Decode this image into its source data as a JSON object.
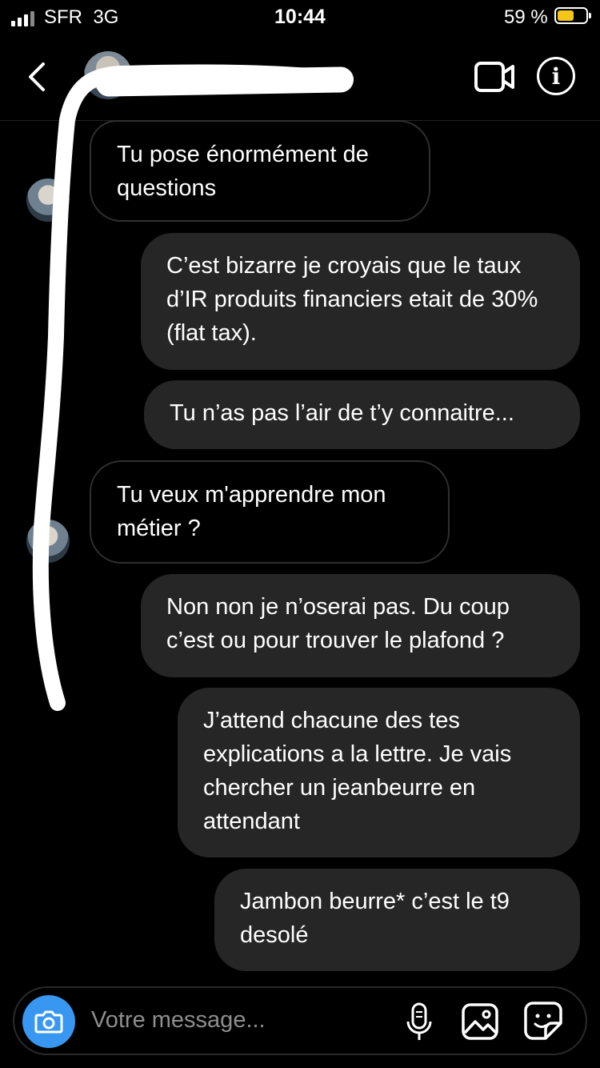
{
  "status_bar": {
    "carrier": "SFR",
    "network": "3G",
    "time": "10:44",
    "battery_percent": "59 %",
    "battery_level": 0.59
  },
  "header": {
    "contact_name": "",
    "icons": [
      "chevron-left-icon",
      "video-call-icon",
      "info-icon"
    ]
  },
  "messages": [
    {
      "side": "in",
      "text": "Tu pose énormément de questions"
    },
    {
      "side": "out",
      "text": "C’est bizarre je croyais que le taux d’IR produits financiers etait de 30% (flat tax)."
    },
    {
      "side": "out",
      "text": "Tu n’as pas l’air de t’y connaitre..."
    },
    {
      "side": "in",
      "text": "Tu veux m'apprendre mon métier ?"
    },
    {
      "side": "out",
      "text": "Non non je n’oserai pas. Du coup c’est ou pour trouver le plafond ?"
    },
    {
      "side": "out",
      "text": "J’attend chacune des tes explications a la lettre. Je vais chercher un jeanbeurre en attendant"
    },
    {
      "side": "out",
      "text": "Jambon beurre* c’est le t9 desolé"
    }
  ],
  "composer": {
    "placeholder": "Votre message...",
    "accent_color": "#3897f0",
    "icons": [
      "camera-icon",
      "microphone-icon",
      "gallery-icon",
      "sticker-icon"
    ]
  }
}
